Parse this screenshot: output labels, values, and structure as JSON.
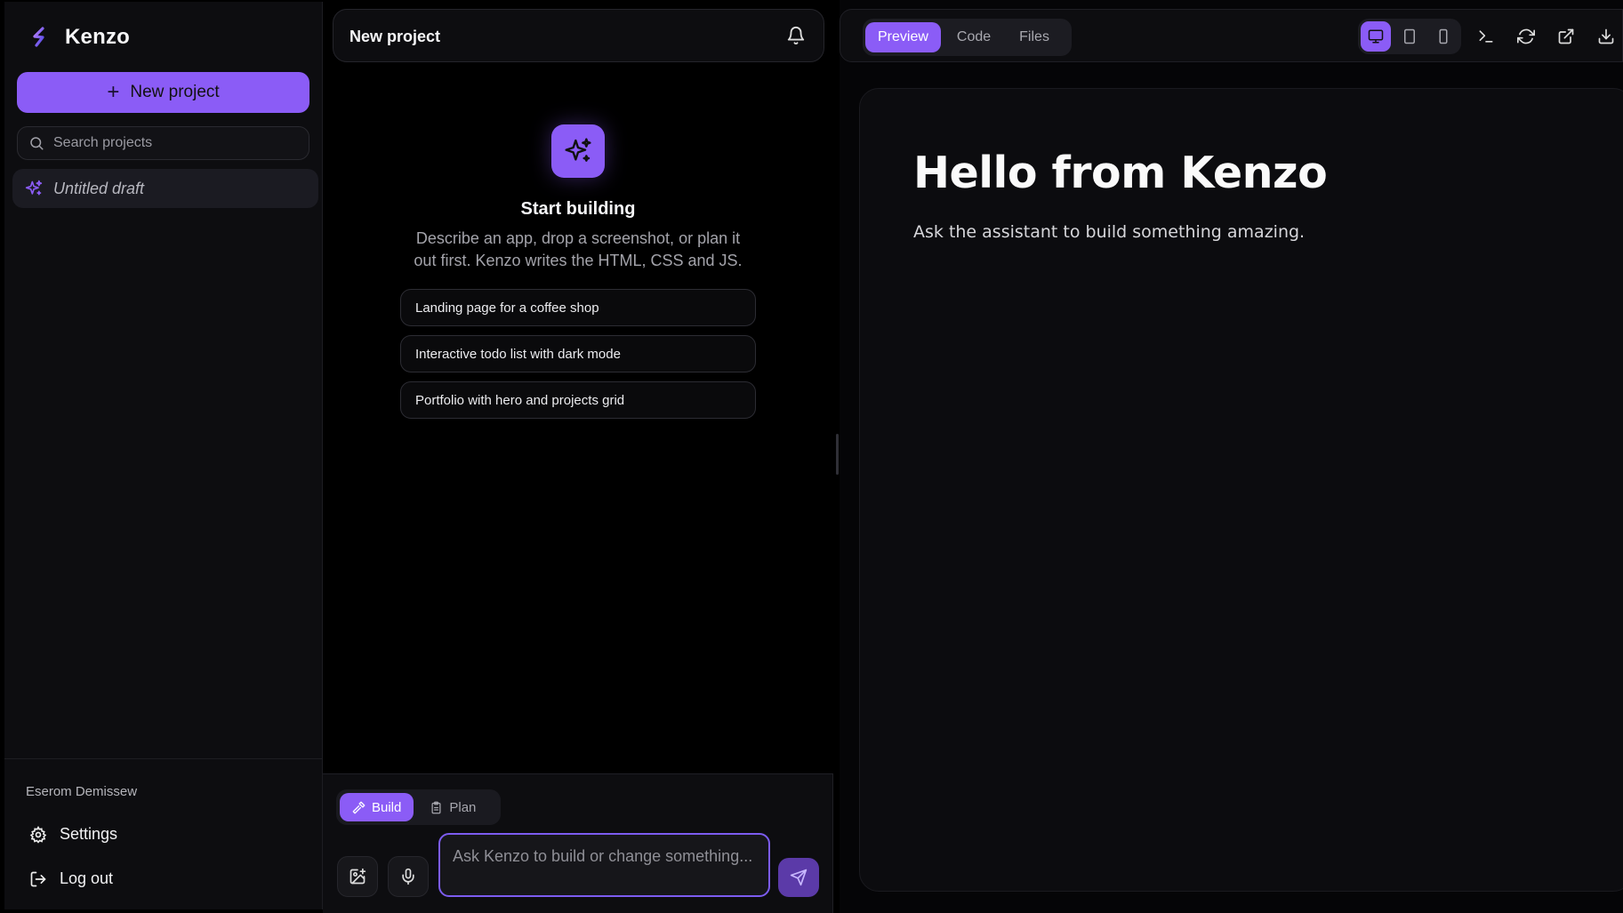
{
  "sidebar": {
    "brand_name": "Kenzo",
    "new_project_label": "New project",
    "search_placeholder": "Search projects",
    "projects": [
      {
        "label": "Untitled draft"
      }
    ],
    "user_name": "Eserom Demissew",
    "settings_label": "Settings",
    "logout_label": "Log out"
  },
  "chat": {
    "title": "New project",
    "empty_state": {
      "title": "Start building",
      "description": "Describe an app, drop a screenshot, or plan it out first. Kenzo writes the HTML, CSS and JS."
    },
    "suggestions": [
      "Landing page for a coffee shop",
      "Interactive todo list with dark mode",
      "Portfolio with hero and projects grid"
    ],
    "modes": {
      "build_label": "Build",
      "plan_label": "Plan",
      "active": "Build"
    },
    "input_placeholder": "Ask Kenzo to build or change something..."
  },
  "preview": {
    "tabs": [
      "Preview",
      "Code",
      "Files"
    ],
    "active_tab": "Preview",
    "device_options": [
      "desktop-icon",
      "tablet-icon",
      "phone-icon"
    ],
    "active_device": "desktop-icon",
    "toolbar_icons": [
      "terminal-icon",
      "refresh-icon",
      "external-link-icon",
      "download-icon"
    ],
    "content": {
      "heading": "Hello from Kenzo",
      "subtext": "Ask the assistant to build something amazing."
    }
  },
  "colors": {
    "accent": "#8b5cf6",
    "background": "#000000",
    "panel": "#0d0d10"
  }
}
